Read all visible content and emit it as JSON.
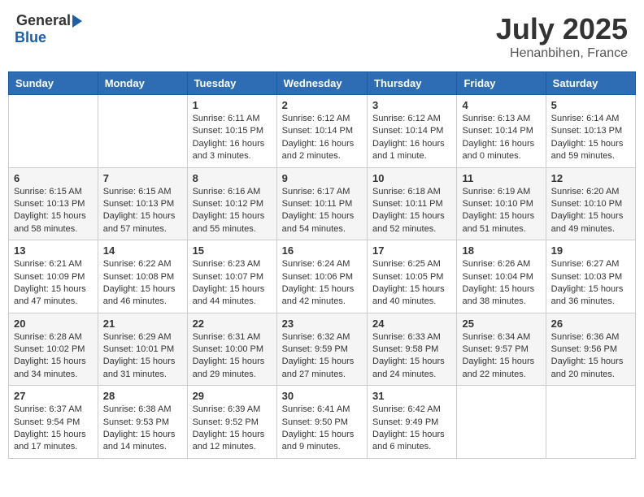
{
  "header": {
    "logo_general": "General",
    "logo_blue": "Blue",
    "month": "July 2025",
    "location": "Henanbihen, France"
  },
  "weekdays": [
    "Sunday",
    "Monday",
    "Tuesday",
    "Wednesday",
    "Thursday",
    "Friday",
    "Saturday"
  ],
  "weeks": [
    [
      {
        "day": "",
        "info": ""
      },
      {
        "day": "",
        "info": ""
      },
      {
        "day": "1",
        "info": "Sunrise: 6:11 AM\nSunset: 10:15 PM\nDaylight: 16 hours\nand 3 minutes."
      },
      {
        "day": "2",
        "info": "Sunrise: 6:12 AM\nSunset: 10:14 PM\nDaylight: 16 hours\nand 2 minutes."
      },
      {
        "day": "3",
        "info": "Sunrise: 6:12 AM\nSunset: 10:14 PM\nDaylight: 16 hours\nand 1 minute."
      },
      {
        "day": "4",
        "info": "Sunrise: 6:13 AM\nSunset: 10:14 PM\nDaylight: 16 hours\nand 0 minutes."
      },
      {
        "day": "5",
        "info": "Sunrise: 6:14 AM\nSunset: 10:13 PM\nDaylight: 15 hours\nand 59 minutes."
      }
    ],
    [
      {
        "day": "6",
        "info": "Sunrise: 6:15 AM\nSunset: 10:13 PM\nDaylight: 15 hours\nand 58 minutes."
      },
      {
        "day": "7",
        "info": "Sunrise: 6:15 AM\nSunset: 10:13 PM\nDaylight: 15 hours\nand 57 minutes."
      },
      {
        "day": "8",
        "info": "Sunrise: 6:16 AM\nSunset: 10:12 PM\nDaylight: 15 hours\nand 55 minutes."
      },
      {
        "day": "9",
        "info": "Sunrise: 6:17 AM\nSunset: 10:11 PM\nDaylight: 15 hours\nand 54 minutes."
      },
      {
        "day": "10",
        "info": "Sunrise: 6:18 AM\nSunset: 10:11 PM\nDaylight: 15 hours\nand 52 minutes."
      },
      {
        "day": "11",
        "info": "Sunrise: 6:19 AM\nSunset: 10:10 PM\nDaylight: 15 hours\nand 51 minutes."
      },
      {
        "day": "12",
        "info": "Sunrise: 6:20 AM\nSunset: 10:10 PM\nDaylight: 15 hours\nand 49 minutes."
      }
    ],
    [
      {
        "day": "13",
        "info": "Sunrise: 6:21 AM\nSunset: 10:09 PM\nDaylight: 15 hours\nand 47 minutes."
      },
      {
        "day": "14",
        "info": "Sunrise: 6:22 AM\nSunset: 10:08 PM\nDaylight: 15 hours\nand 46 minutes."
      },
      {
        "day": "15",
        "info": "Sunrise: 6:23 AM\nSunset: 10:07 PM\nDaylight: 15 hours\nand 44 minutes."
      },
      {
        "day": "16",
        "info": "Sunrise: 6:24 AM\nSunset: 10:06 PM\nDaylight: 15 hours\nand 42 minutes."
      },
      {
        "day": "17",
        "info": "Sunrise: 6:25 AM\nSunset: 10:05 PM\nDaylight: 15 hours\nand 40 minutes."
      },
      {
        "day": "18",
        "info": "Sunrise: 6:26 AM\nSunset: 10:04 PM\nDaylight: 15 hours\nand 38 minutes."
      },
      {
        "day": "19",
        "info": "Sunrise: 6:27 AM\nSunset: 10:03 PM\nDaylight: 15 hours\nand 36 minutes."
      }
    ],
    [
      {
        "day": "20",
        "info": "Sunrise: 6:28 AM\nSunset: 10:02 PM\nDaylight: 15 hours\nand 34 minutes."
      },
      {
        "day": "21",
        "info": "Sunrise: 6:29 AM\nSunset: 10:01 PM\nDaylight: 15 hours\nand 31 minutes."
      },
      {
        "day": "22",
        "info": "Sunrise: 6:31 AM\nSunset: 10:00 PM\nDaylight: 15 hours\nand 29 minutes."
      },
      {
        "day": "23",
        "info": "Sunrise: 6:32 AM\nSunset: 9:59 PM\nDaylight: 15 hours\nand 27 minutes."
      },
      {
        "day": "24",
        "info": "Sunrise: 6:33 AM\nSunset: 9:58 PM\nDaylight: 15 hours\nand 24 minutes."
      },
      {
        "day": "25",
        "info": "Sunrise: 6:34 AM\nSunset: 9:57 PM\nDaylight: 15 hours\nand 22 minutes."
      },
      {
        "day": "26",
        "info": "Sunrise: 6:36 AM\nSunset: 9:56 PM\nDaylight: 15 hours\nand 20 minutes."
      }
    ],
    [
      {
        "day": "27",
        "info": "Sunrise: 6:37 AM\nSunset: 9:54 PM\nDaylight: 15 hours\nand 17 minutes."
      },
      {
        "day": "28",
        "info": "Sunrise: 6:38 AM\nSunset: 9:53 PM\nDaylight: 15 hours\nand 14 minutes."
      },
      {
        "day": "29",
        "info": "Sunrise: 6:39 AM\nSunset: 9:52 PM\nDaylight: 15 hours\nand 12 minutes."
      },
      {
        "day": "30",
        "info": "Sunrise: 6:41 AM\nSunset: 9:50 PM\nDaylight: 15 hours\nand 9 minutes."
      },
      {
        "day": "31",
        "info": "Sunrise: 6:42 AM\nSunset: 9:49 PM\nDaylight: 15 hours\nand 6 minutes."
      },
      {
        "day": "",
        "info": ""
      },
      {
        "day": "",
        "info": ""
      }
    ]
  ]
}
